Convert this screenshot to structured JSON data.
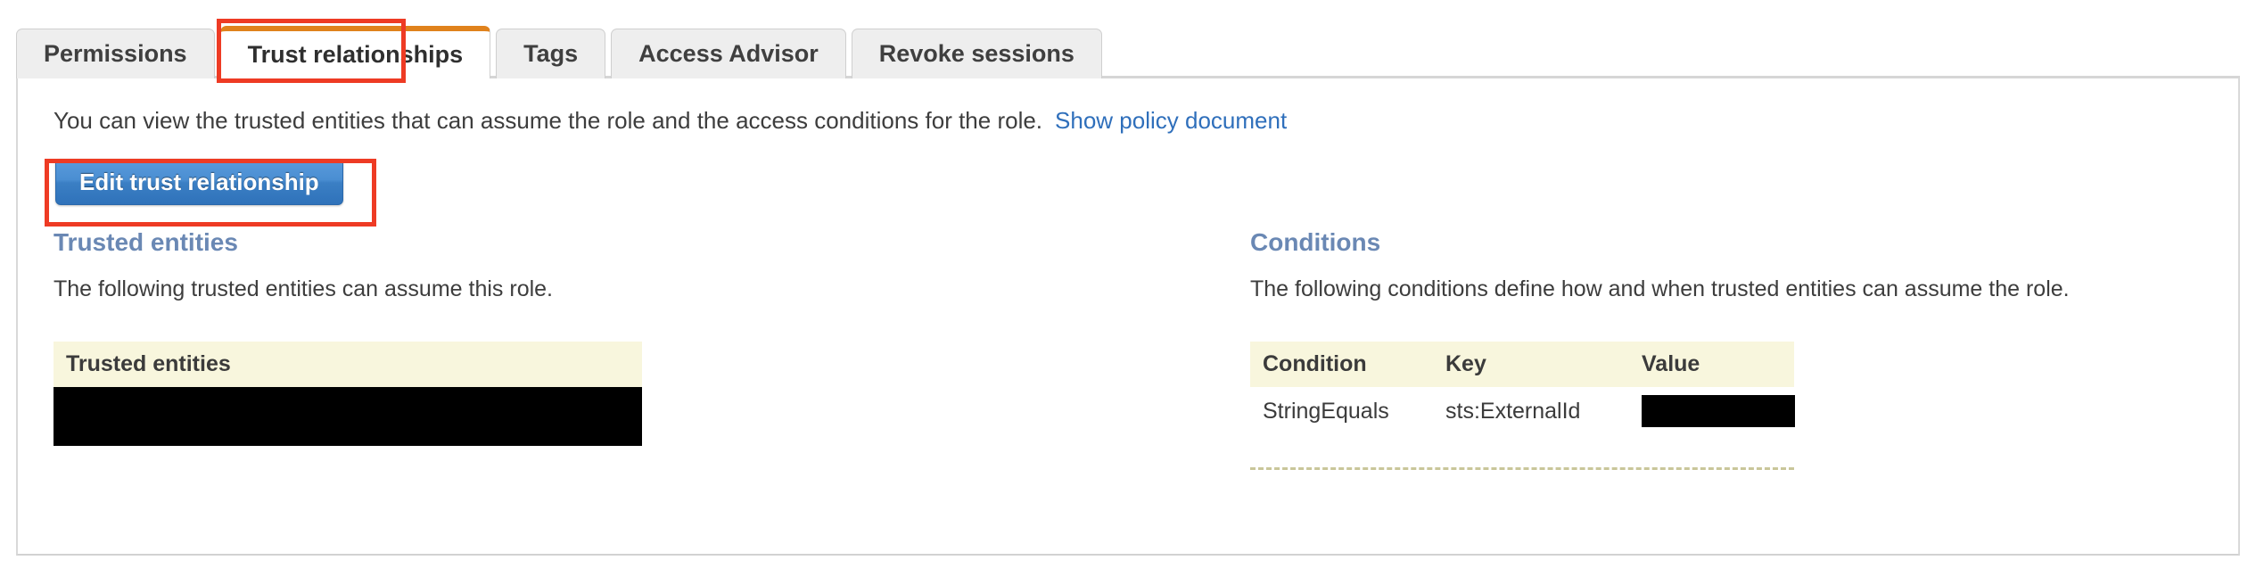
{
  "tabs": [
    {
      "label": "Permissions",
      "active": false
    },
    {
      "label": "Trust relationships",
      "active": true
    },
    {
      "label": "Tags",
      "active": false
    },
    {
      "label": "Access Advisor",
      "active": false
    },
    {
      "label": "Revoke sessions",
      "active": false
    }
  ],
  "lead": {
    "text": "You can view the trusted entities that can assume the role and the access conditions for the role.",
    "link_label": "Show policy document"
  },
  "actions": {
    "edit_trust_label": "Edit trust relationship"
  },
  "trusted_entities": {
    "title": "Trusted entities",
    "description": "The following trusted entities can assume this role.",
    "table": {
      "header": "Trusted entities",
      "rows": [
        {
          "value": "",
          "redacted": true
        }
      ]
    }
  },
  "conditions": {
    "title": "Conditions",
    "description": "The following conditions define how and when trusted entities can assume the role.",
    "table": {
      "headers": [
        "Condition",
        "Key",
        "Value"
      ],
      "rows": [
        {
          "condition": "StringEquals",
          "key": "sts:ExternalId",
          "value": "",
          "value_redacted": true
        }
      ]
    }
  },
  "colors": {
    "active_tab_accent": "#e0821c",
    "annotation": "#ee3b24",
    "link": "#2f6fbb",
    "section_heading": "#6a88b4",
    "table_header_bg": "#f8f6dd",
    "button_blue": "#3b7fc4",
    "dashed_rule": "#c9c69a"
  }
}
